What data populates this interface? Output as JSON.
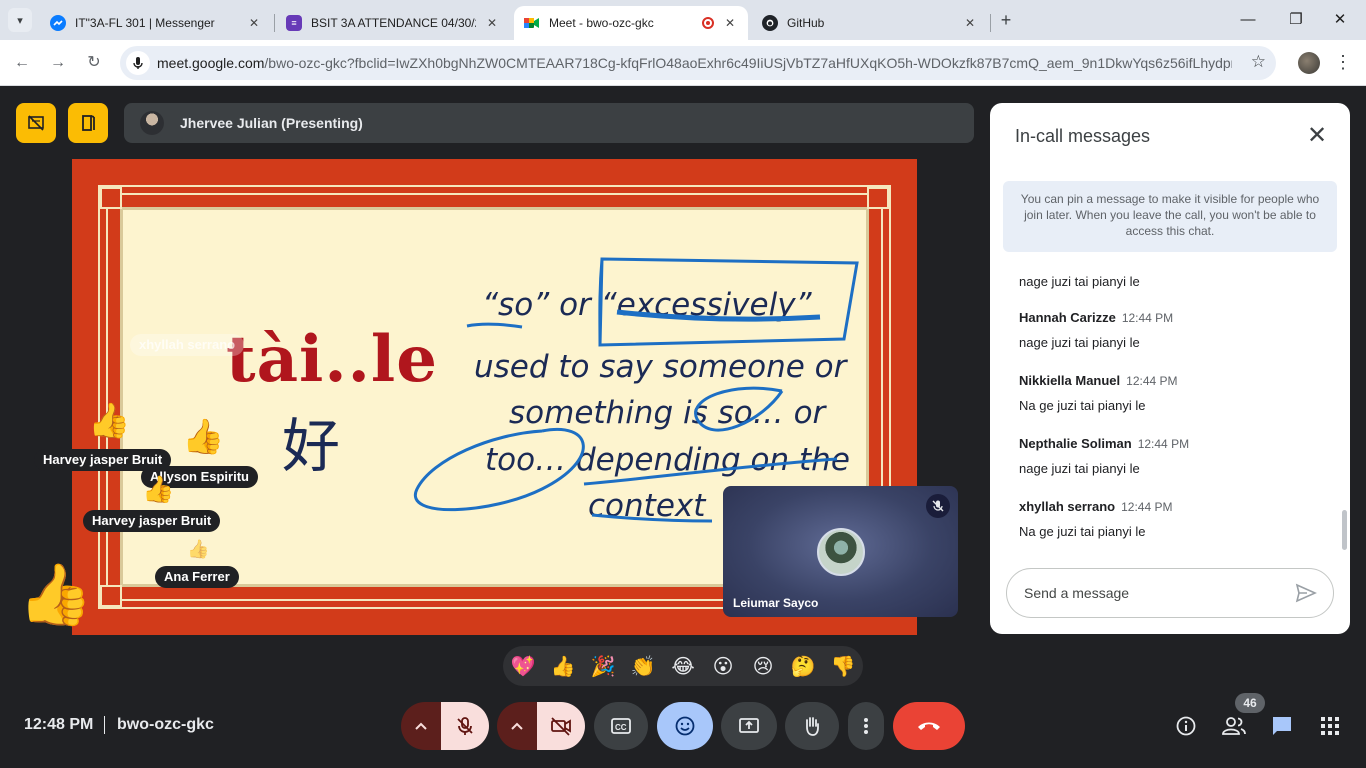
{
  "browser": {
    "tabs": [
      {
        "title": "IT\"3A-FL 301 | Messenger",
        "favicon": "messenger-icon"
      },
      {
        "title": "BSIT 3A ATTENDANCE 04/30/25",
        "favicon": "forms-icon"
      },
      {
        "title": "Meet - bwo-ozc-gkc",
        "favicon": "meet-icon",
        "active": true
      },
      {
        "title": "GitHub",
        "favicon": "github-icon"
      }
    ],
    "url_host": "meet.google.com",
    "url_path": "/bwo-ozc-gkc?fbclid=IwZXh0bgNhZW0CMTEAAR718Cg-kfqFrlO48aoExhr6c49IiUSjVbTZ7aHfUXqKO5h-WDOkzfk87B7cmQ_aem_9n1DkwYqs6z56ifLhydpnA"
  },
  "meeting": {
    "presenter_label": "Jhervee Julian (Presenting)",
    "time": "12:48 PM",
    "code": "bwo-ozc-gkc",
    "participant_count": "46"
  },
  "slide": {
    "pinyin": "tài..le",
    "hanzi": "好",
    "lines": [
      "“so” or “excessively”",
      "used to say someone or",
      "something is so… or",
      "too… depending on the",
      "context"
    ]
  },
  "reactions": [
    {
      "name": "xhyllah serrano",
      "faded": true
    },
    {
      "name": "Harvey jasper Bruit"
    },
    {
      "name": "Allyson Espiritu"
    },
    {
      "name": "Harvey jasper Bruit"
    },
    {
      "name": "Ana Ferrer"
    }
  ],
  "tile": {
    "name": "Leiumar Sayco"
  },
  "chat": {
    "title": "In-call messages",
    "info": "You can pin a message to make it visible for people who join later. When you leave the call, you won't be able to access this chat.",
    "first_text": "nage juzi tai pianyi le",
    "messages": [
      {
        "sender": "Hannah Carizze",
        "time": "12:44 PM",
        "text": "nage juzi tai pianyi le"
      },
      {
        "sender": "Nikkiella Manuel",
        "time": "12:44 PM",
        "text": "Na ge juzi tai pianyi le"
      },
      {
        "sender": "Nepthalie Soliman",
        "time": "12:44 PM",
        "text": "nage juzi tai pianyi le"
      },
      {
        "sender": "xhyllah serrano",
        "time": "12:44 PM",
        "text": "Na ge juzi tai pianyi le"
      }
    ],
    "input_placeholder": "Send a message"
  },
  "emoji_bar": [
    "💖",
    "👍",
    "🎉",
    "👏",
    "😂",
    "😮",
    "😢",
    "🤔",
    "👎"
  ],
  "colors": {
    "accent_yellow": "#fbbc04",
    "hangup_red": "#ea4335",
    "active_blue": "#a8c7fa",
    "muted_pink": "#f9dedc"
  }
}
